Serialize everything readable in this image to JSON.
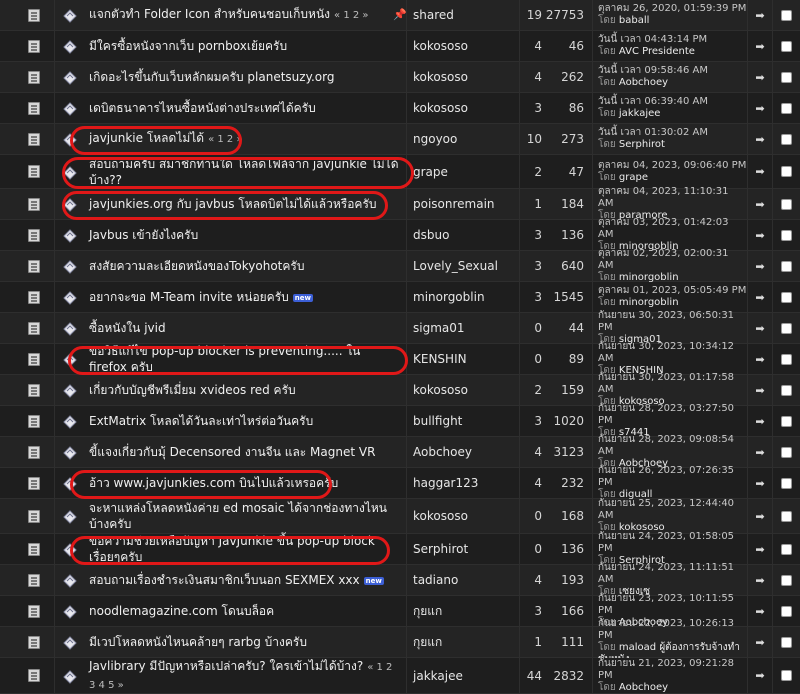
{
  "by_label": "โดย",
  "go_icon": "arrow-to-last-post-icon",
  "topics": [
    {
      "title": "แจกตัวทำ Folder Icon สำหรับคนชอบเก็บหนัง",
      "pages": "« 1 2 »",
      "is_new": false,
      "sticky": true,
      "author": "shared",
      "replies": "19",
      "views": "27753",
      "last_date": "ตุลาคม 26, 2020, 01:59:39 PM",
      "last_user": "baball"
    },
    {
      "title": "มีใครซื้อหนังจากเว็บ pornboxเย้ยครับ",
      "pages": "",
      "is_new": false,
      "sticky": false,
      "author": "kokososo",
      "replies": "4",
      "views": "46",
      "last_date": "วันนี้ เวลา 04:43:14 PM",
      "last_user": "AVC Presidente"
    },
    {
      "title": "เกิดอะไรขึ้นกับเว็บหลักผมครับ planetsuzy.org",
      "pages": "",
      "is_new": false,
      "sticky": false,
      "author": "kokososo",
      "replies": "4",
      "views": "262",
      "last_date": "วันนี้ เวลา 09:58:46 AM",
      "last_user": "Aobchoey"
    },
    {
      "title": "เดบิตธนาคารไหนซื้อหนังต่างประเทศได้ครับ",
      "pages": "",
      "is_new": false,
      "sticky": false,
      "author": "kokososo",
      "replies": "3",
      "views": "86",
      "last_date": "วันนี้ เวลา 06:39:40 AM",
      "last_user": "jakkajee"
    },
    {
      "title": "javjunkie โหลดไม่ได้",
      "pages": "« 1 2 »",
      "is_new": false,
      "sticky": false,
      "author": "ngoyoo",
      "replies": "10",
      "views": "273",
      "last_date": "วันนี้ เวลา 01:30:02 AM",
      "last_user": "Serphirot"
    },
    {
      "title": "สอบถามครับ สมาชิกท่านใด โหลดไฟล์จาก javjunkie ไม่ได้บ้าง??",
      "pages": "",
      "is_new": false,
      "sticky": false,
      "author": "grape",
      "replies": "2",
      "views": "47",
      "last_date": "ตุลาคม 04, 2023, 09:06:40 PM",
      "last_user": "grape"
    },
    {
      "title": "javjunkies.org กับ javbus โหลดบิตไม่ได้แล้วหรือครับ",
      "pages": "",
      "is_new": false,
      "sticky": false,
      "author": "poisonremain",
      "replies": "1",
      "views": "184",
      "last_date": "ตุลาคม 04, 2023, 11:10:31 AM",
      "last_user": "paramore"
    },
    {
      "title": "Javbus เข้ายังไงครับ",
      "pages": "",
      "is_new": false,
      "sticky": false,
      "author": "dsbuo",
      "replies": "3",
      "views": "136",
      "last_date": "ตุลาคม 03, 2023, 01:42:03 AM",
      "last_user": "minorgoblin"
    },
    {
      "title": "สงสัยความละเอียดหนังของTokyohotครับ",
      "pages": "",
      "is_new": false,
      "sticky": false,
      "author": "Lovely_Sexual",
      "replies": "3",
      "views": "640",
      "last_date": "ตุลาคม 02, 2023, 02:00:31 AM",
      "last_user": "minorgoblin"
    },
    {
      "title": "อยากจะขอ M-Team invite หน่อยครับ",
      "pages": "",
      "is_new": true,
      "sticky": false,
      "author": "minorgoblin",
      "replies": "3",
      "views": "1545",
      "last_date": "ตุลาคม 01, 2023, 05:05:49 PM",
      "last_user": "minorgoblin"
    },
    {
      "title": "ซื้อหนังใน jvid",
      "pages": "",
      "is_new": false,
      "sticky": false,
      "author": "sigma01",
      "replies": "0",
      "views": "44",
      "last_date": "กันยายน 30, 2023, 06:50:31 PM",
      "last_user": "sigma01"
    },
    {
      "title": "ขอวิธีแก้ไข pop-up blocker is preventing..... ใน firefox ครับ",
      "pages": "",
      "is_new": false,
      "sticky": false,
      "author": "KENSHIN",
      "replies": "0",
      "views": "89",
      "last_date": "กันยายน 30, 2023, 10:34:12 AM",
      "last_user": "KENSHIN"
    },
    {
      "title": "เกี่ยวกับบัญชีพรีเมี่ยม xvideos red ครับ",
      "pages": "",
      "is_new": false,
      "sticky": false,
      "author": "kokososo",
      "replies": "2",
      "views": "159",
      "last_date": "กันยายน 30, 2023, 01:17:58 AM",
      "last_user": "kokososo"
    },
    {
      "title": "ExtMatrix โหลดได้วันละเท่าไหร่ต่อวันครับ",
      "pages": "",
      "is_new": false,
      "sticky": false,
      "author": "bullfight",
      "replies": "3",
      "views": "1020",
      "last_date": "กันยายน 28, 2023, 03:27:50 PM",
      "last_user": "s7441"
    },
    {
      "title": "ขี้แจงเกี่ยวกับมุ้ Decensored งานจีน และ Magnet VR",
      "pages": "",
      "is_new": false,
      "sticky": false,
      "author": "Aobchoey",
      "replies": "4",
      "views": "3123",
      "last_date": "กันยายน 28, 2023, 09:08:54 AM",
      "last_user": "Aobchoey"
    },
    {
      "title": "อ้าว www.javjunkies.com บินไปแล้วเหรอครับ",
      "pages": "",
      "is_new": false,
      "sticky": false,
      "author": "haggar123",
      "replies": "4",
      "views": "232",
      "last_date": "กันยายน 26, 2023, 07:26:35 PM",
      "last_user": "diguall"
    },
    {
      "title": "จะหาแหล่งโหลดหนังค่าย ed mosaic ได้จากช่องทางไหนบ้างครับ",
      "pages": "",
      "is_new": false,
      "sticky": false,
      "author": "kokososo",
      "replies": "0",
      "views": "168",
      "last_date": "กันยายน 25, 2023, 12:44:40 AM",
      "last_user": "kokososo"
    },
    {
      "title": "ขอความช่วยเหลือปัญหา JavJunkie ขึ้น pop-up block เรื่อยๆครับ",
      "pages": "",
      "is_new": false,
      "sticky": false,
      "author": "Serphirot",
      "replies": "0",
      "views": "136",
      "last_date": "กันยายน 24, 2023, 01:58:05 PM",
      "last_user": "Serphirot"
    },
    {
      "title": "สอบถามเรื่องชำระเงินสมาชิกเว็บนอก SEXMEX xxx",
      "pages": "",
      "is_new": true,
      "sticky": false,
      "author": "tadiano",
      "replies": "4",
      "views": "193",
      "last_date": "กันยายน 24, 2023, 11:11:51 AM",
      "last_user": "เซยงเซ"
    },
    {
      "title": "noodlemagazine.com โดนบล็อค",
      "pages": "",
      "is_new": false,
      "sticky": false,
      "author": "กุยแก",
      "replies": "3",
      "views": "166",
      "last_date": "กันยายน 23, 2023, 10:11:55 PM",
      "last_user": "Aobchoey"
    },
    {
      "title": "มีเวปโหลดหนังไหนคล้ายๆ rarbg บ้างครับ",
      "pages": "",
      "is_new": false,
      "sticky": false,
      "author": "กุยแก",
      "replies": "1",
      "views": "111",
      "last_date": "กันยายน 22, 2023, 10:26:13 PM",
      "last_user": "maload ผู้ต้องการรับจ้างทำซับหนัง"
    },
    {
      "title": "Javlibrary มีปัญหาหรือเปล่าครับ? ใครเข้าไม่ได้บ้าง?",
      "pages": "« 1 2 3 4 5 »",
      "is_new": false,
      "sticky": false,
      "author": "jakkajee",
      "replies": "44",
      "views": "2832",
      "last_date": "กันยายน 21, 2023, 09:21:28 PM",
      "last_user": "Aobchoey"
    }
  ],
  "new_badge_text": "new",
  "highlight_color": "#e01818"
}
